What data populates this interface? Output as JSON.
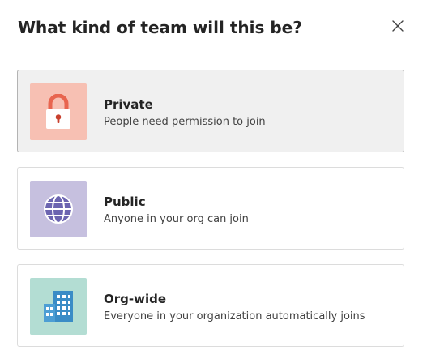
{
  "dialog": {
    "title": "What kind of team will this be?",
    "close_icon": "close-icon"
  },
  "options": [
    {
      "id": "private",
      "title": "Private",
      "description": "People need permission to join",
      "icon": "lock-icon",
      "icon_bg": "#f7c0b3",
      "icon_color": "#e8654f",
      "selected": true
    },
    {
      "id": "public",
      "title": "Public",
      "description": "Anyone in your org can join",
      "icon": "globe-icon",
      "icon_bg": "#c6c0df",
      "icon_color": "#6b64b0",
      "selected": false
    },
    {
      "id": "org-wide",
      "title": "Org-wide",
      "description": "Everyone in your organization automatically joins",
      "icon": "building-icon",
      "icon_bg": "#b3ddd3",
      "icon_color": "#3a8cc6",
      "selected": false
    }
  ]
}
